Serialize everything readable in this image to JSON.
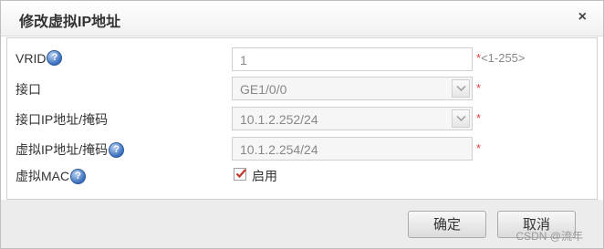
{
  "dialog": {
    "title": "修改虚拟IP地址",
    "close_glyph": "×"
  },
  "form": {
    "vrid": {
      "label": "VRID",
      "value": "1",
      "required": "*",
      "hint": "<1-255>"
    },
    "interface": {
      "label": "接口",
      "value": "GE1/0/0",
      "required": "*"
    },
    "interface_ip": {
      "label": "接口IP地址/掩码",
      "value": "10.1.2.252/24",
      "required": "*"
    },
    "virtual_ip": {
      "label": "虚拟IP地址/掩码",
      "value": "10.1.2.254/24",
      "required": "*"
    },
    "virtual_mac": {
      "label": "虚拟MAC",
      "checkbox_label": "启用",
      "checked": true
    },
    "help_glyph": "?"
  },
  "footer": {
    "ok_label": "确定",
    "cancel_label": "取消",
    "watermark": "CSDN @流年"
  }
}
